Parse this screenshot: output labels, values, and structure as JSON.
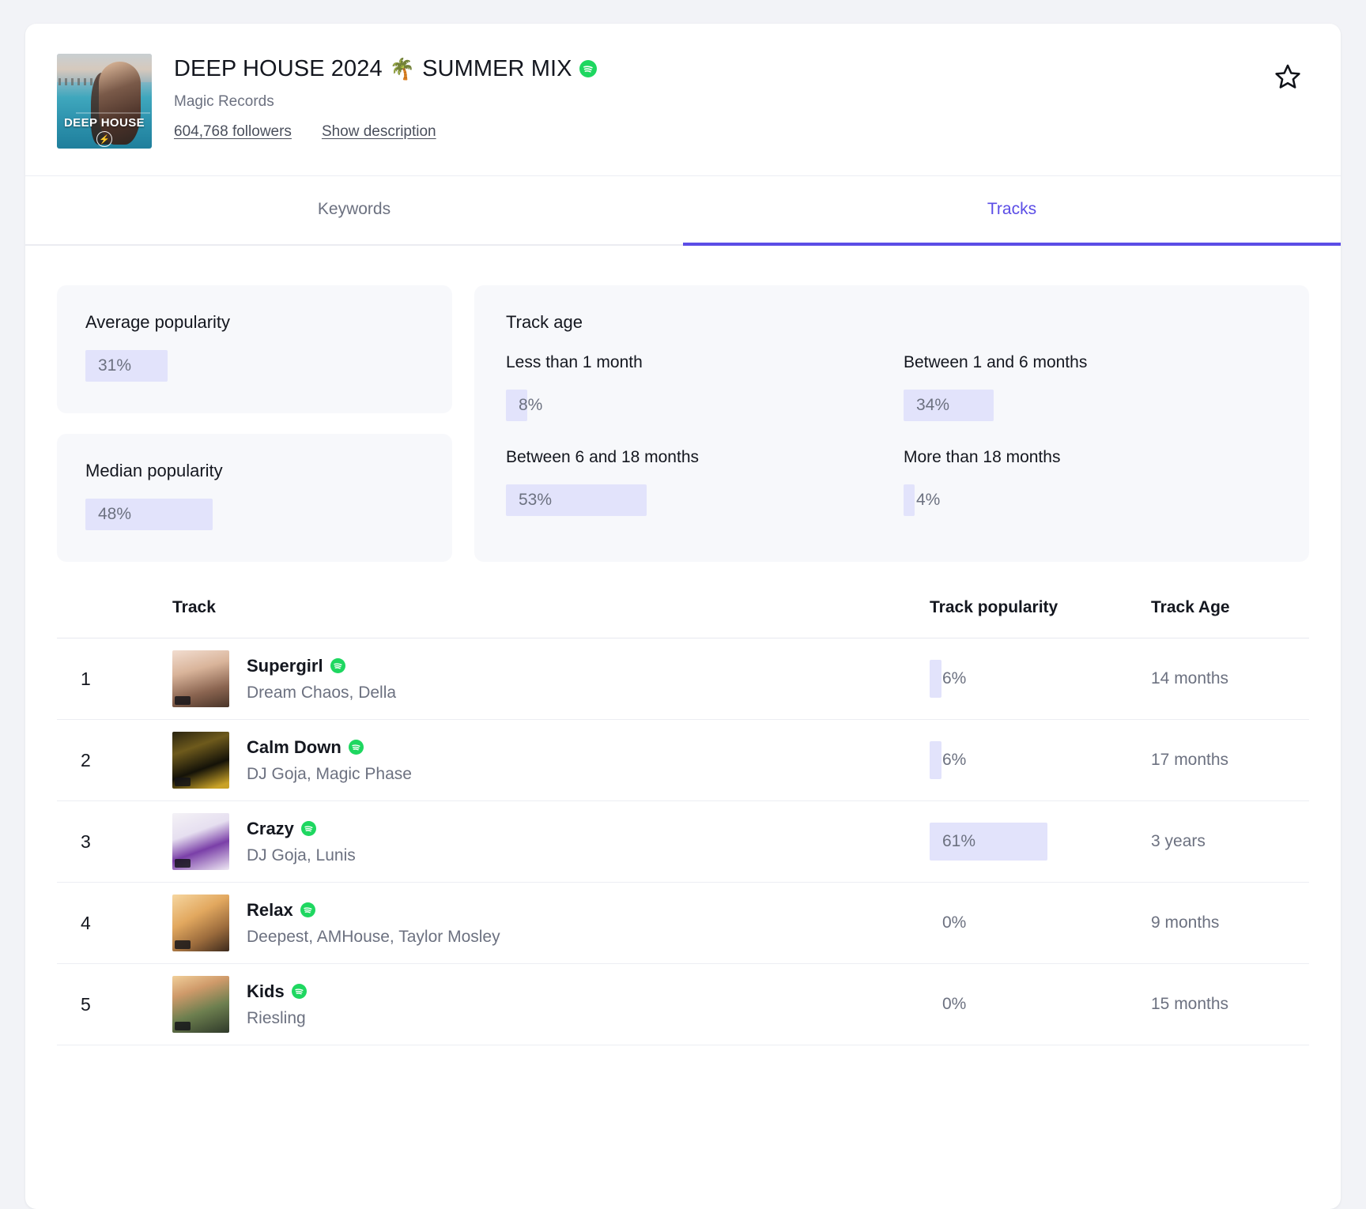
{
  "header": {
    "cover_text": "DEEP HOUSE",
    "cover_badge": "⚡",
    "title": "DEEP HOUSE 2024",
    "title_emoji": "🌴",
    "title_tail": "SUMMER MIX",
    "owner": "Magic Records",
    "followers": "604,768 followers",
    "show_description": "Show description",
    "star_icon": "star-outline-icon",
    "spotify_icon": "spotify-icon"
  },
  "tabs": [
    {
      "label": "Keywords",
      "active": false
    },
    {
      "label": "Tracks",
      "active": true
    }
  ],
  "stats": {
    "average": {
      "title": "Average popularity",
      "value": "31%",
      "percent": 31
    },
    "median": {
      "title": "Median popularity",
      "value": "48%",
      "percent": 48
    },
    "track_age": {
      "title": "Track age",
      "buckets": [
        {
          "label": "Less than 1 month",
          "value": "8%",
          "percent": 8
        },
        {
          "label": "Between 1 and 6 months",
          "value": "34%",
          "percent": 34
        },
        {
          "label": "Between 6 and 18 months",
          "value": "53%",
          "percent": 53
        },
        {
          "label": "More than 18 months",
          "value": "4%",
          "percent": 4
        }
      ]
    }
  },
  "table": {
    "headers": {
      "track": "Track",
      "popularity": "Track popularity",
      "age": "Track Age"
    },
    "rows": [
      {
        "rank": "1",
        "name": "Supergirl",
        "artists": "Dream Chaos, Della",
        "popularity": "6%",
        "popularity_pct": 6,
        "age": "14 months"
      },
      {
        "rank": "2",
        "name": "Calm Down",
        "artists": "DJ Goja, Magic Phase",
        "popularity": "6%",
        "popularity_pct": 6,
        "age": "17 months"
      },
      {
        "rank": "3",
        "name": "Crazy",
        "artists": "DJ Goja, Lunis",
        "popularity": "61%",
        "popularity_pct": 61,
        "age": "3 years"
      },
      {
        "rank": "4",
        "name": "Relax",
        "artists": "Deepest, AMHouse, Taylor Mosley",
        "popularity": "0%",
        "popularity_pct": 0,
        "age": "9 months"
      },
      {
        "rank": "5",
        "name": "Kids",
        "artists": "Riesling",
        "popularity": "0%",
        "popularity_pct": 0,
        "age": "15 months"
      }
    ]
  },
  "colors": {
    "accent": "#5b4de6",
    "bar": "#e2e3fb",
    "spotify": "#1ed760",
    "text": "#14171f",
    "muted": "#6c7180"
  }
}
